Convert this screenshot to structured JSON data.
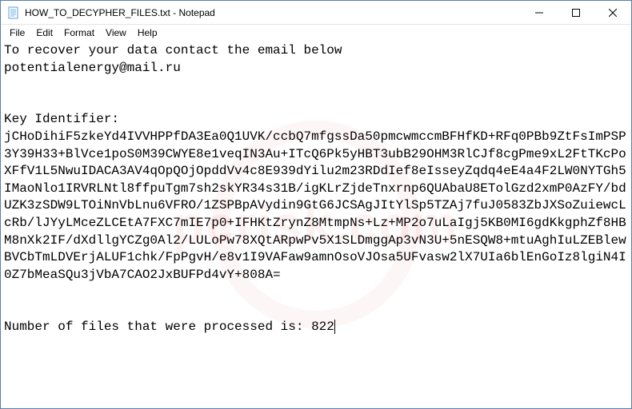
{
  "titlebar": {
    "title": "HOW_TO_DECYPHER_FILES.txt - Notepad"
  },
  "menu": {
    "file": "File",
    "edit": "Edit",
    "format": "Format",
    "view": "View",
    "help": "Help"
  },
  "body": {
    "line1": "To recover your data contact the email below",
    "line2": "potentialenergy@mail.ru",
    "blank1": "",
    "blank2": "",
    "key_label": "Key Identifier:",
    "key_value": "jCHoDihiF5zkeYd4IVVHPPfDA3Ea0Q1UVK/ccbQ7mfgssDa50pmcwmccmBFHfKD+RFq0PBb9ZtFsImPSP3Y39H33+BlVce1poS0M39CWYE8e1veqIN3Au+ITcQ6Pk5yHBT3ubB29OHM3RlCJf8cgPme9xL2FtTKcPoXFfV1L5NwuIDACA3AV4qOpQOjOpddVv4c8E939dYilu2m23RDdIef8eIsseyZqdq4eE4a4F2LW0NYTGh5IMaoNlo1IRVRLNtl8ffpuTgm7sh2skYR34s31B/igKLrZjdeTnxrnp6QUAbaU8ETolGzd2xmP0AzFY/bdUZK3zSDW9LTOiNnVbLnu6VFRO/1ZSPBpAVydin9GtG6JCSAgJItYlSp5TZAj7fuJ0583ZbJXSoZuiewcLcRb/lJYyLMceZLCEtA7FXC7mIE7p0+IFHKtZrynZ8MtmpNs+Lz+MP2o7uLaIgj5KB0MI6gdKkgphZf8HBM8nXk2IF/dXdllgYCZg0Al2/LULoPw78XQtARpwPv5X1SLDmggAp3vN3U+5nESQW8+mtuAghIuLZEBlewBVCbTmLDVErjALUF1chk/FpPgvH/e8v1I9VAFaw9amnOsoVJOsa5UFvasw2lX7UIa6blEnGoIz8lgiN4I0Z7bMeaSQu3jVbA7CAO2JxBUFPd4vY+808A=",
    "blank3": "",
    "blank4": "",
    "footer_prefix": "Number of files that were processed is: ",
    "footer_count": "822"
  }
}
